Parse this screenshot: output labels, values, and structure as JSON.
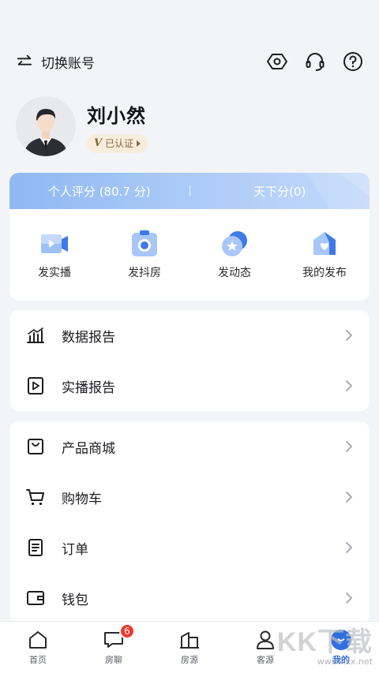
{
  "header": {
    "switch_account_label": "切换账号",
    "icons": [
      "settings-icon",
      "customer-service-icon",
      "help-icon"
    ]
  },
  "profile": {
    "name": "刘小然",
    "verified_mark": "V",
    "verified_label": "已认证"
  },
  "score": {
    "personal_score": "个人评分 (80.7 分)",
    "tianxia_score": "天下分(0)"
  },
  "quick_actions": [
    {
      "label": "发实播",
      "icon": "live-video-icon"
    },
    {
      "label": "发抖房",
      "icon": "camera-icon"
    },
    {
      "label": "发动态",
      "icon": "star-post-icon"
    },
    {
      "label": "我的发布",
      "icon": "house-heart-icon"
    }
  ],
  "menu_group_1": [
    {
      "label": "数据报告",
      "icon": "chart-icon"
    },
    {
      "label": "实播报告",
      "icon": "play-report-icon"
    }
  ],
  "menu_group_2": [
    {
      "label": "产品商城",
      "icon": "shopping-bag-icon"
    },
    {
      "label": "购物车",
      "icon": "cart-icon"
    },
    {
      "label": "订单",
      "icon": "order-icon"
    },
    {
      "label": "钱包",
      "icon": "wallet-icon"
    }
  ],
  "tab_bar": {
    "tabs": [
      {
        "label": "首页",
        "icon": "home-icon"
      },
      {
        "label": "房聊",
        "icon": "chat-icon",
        "badge": "6"
      },
      {
        "label": "房源",
        "icon": "building-icon"
      },
      {
        "label": "客源",
        "icon": "person-icon"
      },
      {
        "label": "我的",
        "icon": "me-icon"
      }
    ],
    "active": "我的"
  },
  "watermark": {
    "main": "KK下载",
    "sub": "www.kkx.net"
  },
  "colors": {
    "accent": "#2f6fe0",
    "badge_red": "#f0372d",
    "verified_bg": "#f7eddd",
    "page_bg": "#f3f4f8"
  }
}
